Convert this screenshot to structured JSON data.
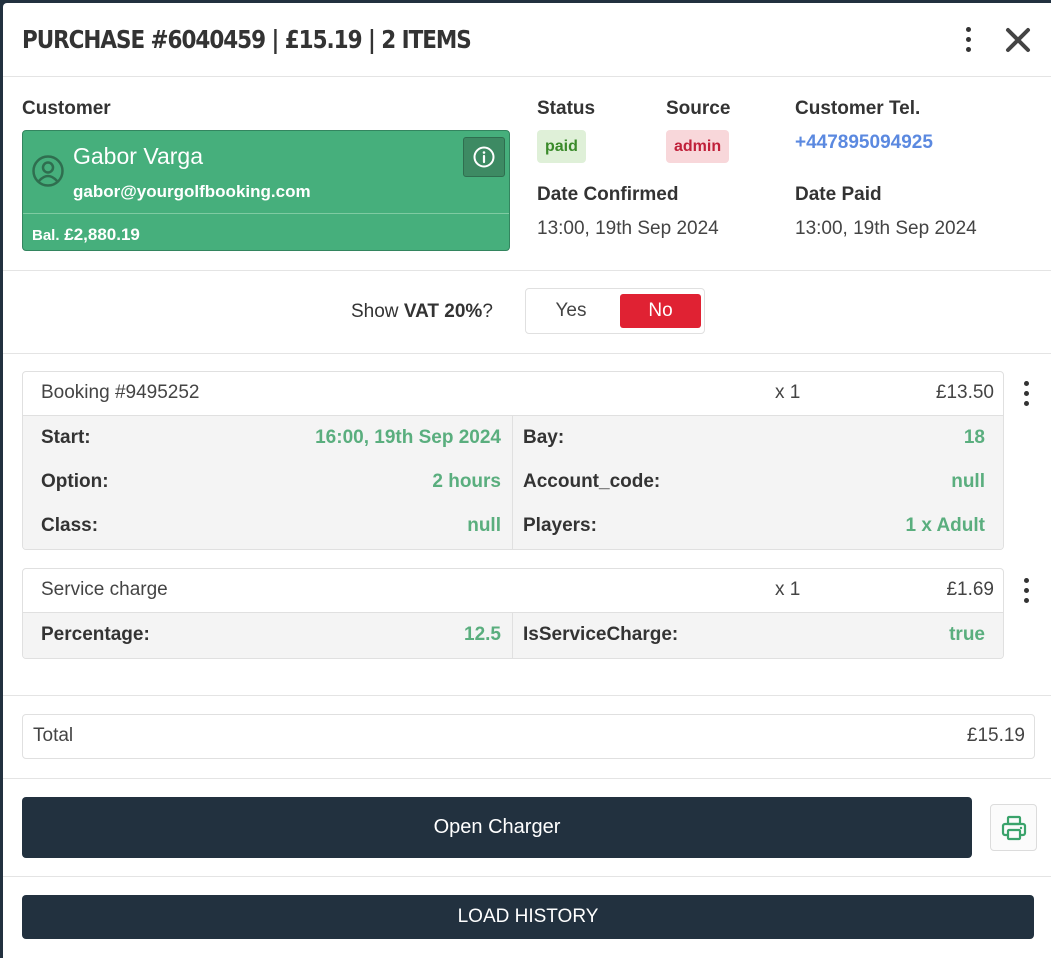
{
  "header": {
    "title": "PURCHASE #6040459 | £15.19 | 2 ITEMS"
  },
  "customer": {
    "label": "Customer",
    "name": "Gabor Varga",
    "email": "gabor@yourgolfbooking.com",
    "balance_prefix": "Bal.",
    "balance": "£2,880.19"
  },
  "status": {
    "label": "Status",
    "value": "paid"
  },
  "source": {
    "label": "Source",
    "value": "admin"
  },
  "tel": {
    "label": "Customer Tel.",
    "value": "+447895094925"
  },
  "date_confirmed": {
    "label": "Date Confirmed",
    "value": "13:00, 19th Sep 2024"
  },
  "date_paid": {
    "label": "Date Paid",
    "value": "13:00, 19th Sep 2024"
  },
  "vat": {
    "prefix": "Show ",
    "bold": "VAT 20%",
    "suffix": "?",
    "yes": "Yes",
    "no": "No",
    "selected": "No"
  },
  "items": [
    {
      "name": "Booking #9495252",
      "qty": "x 1",
      "price": "£13.50",
      "props_left": [
        {
          "key": "Start:",
          "value": "16:00, 19th Sep 2024"
        },
        {
          "key": "Option:",
          "value": "2 hours"
        },
        {
          "key": "Class:",
          "value": "null"
        }
      ],
      "props_right": [
        {
          "key": "Bay:",
          "value": "18"
        },
        {
          "key": "Account_code:",
          "value": "null"
        },
        {
          "key": "Players:",
          "value": "1 x Adult"
        }
      ]
    },
    {
      "name": "Service charge",
      "qty": "x 1",
      "price": "£1.69",
      "props_left": [
        {
          "key": "Percentage:",
          "value": "12.5"
        }
      ],
      "props_right": [
        {
          "key": "IsServiceCharge:",
          "value": "true"
        }
      ]
    }
  ],
  "total": {
    "label": "Total",
    "value": "£15.19"
  },
  "actions": {
    "open_charger": "Open Charger",
    "load_history": "LOAD HISTORY",
    "print_icon": "printer-icon"
  },
  "colors": {
    "navy": "#22313f",
    "customer_green": "#46af7c",
    "value_green": "#5aae7e",
    "danger_red": "#e02233",
    "link_blue": "#5b89e0"
  }
}
